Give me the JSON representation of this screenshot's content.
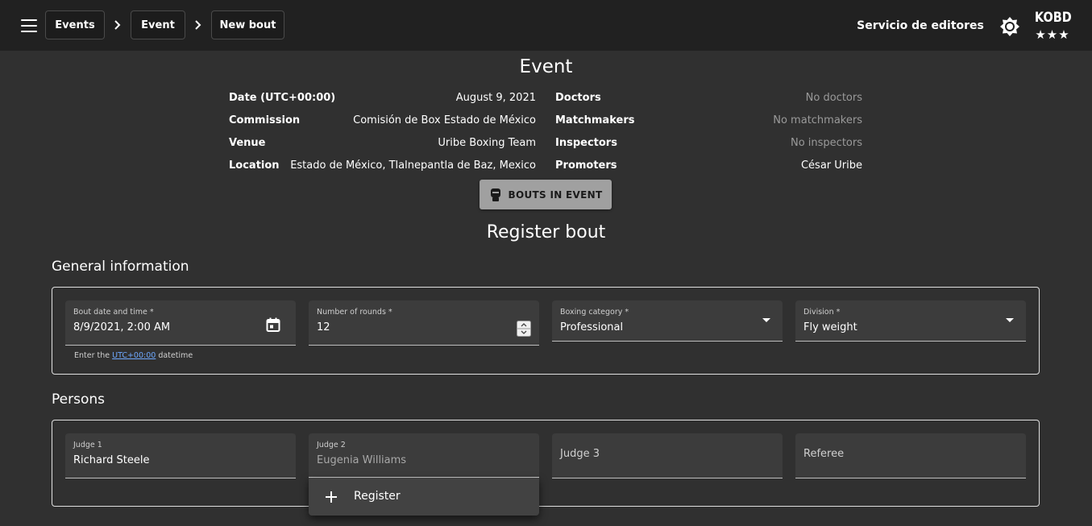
{
  "header": {
    "breadcrumbs": [
      "Events",
      "Event",
      "New bout"
    ],
    "service_link": "Servicio de editores",
    "logo_text": "KOBD",
    "logo_stars": "★★★"
  },
  "event": {
    "title": "Event",
    "left": [
      {
        "label": "Date (UTC+00:00)",
        "value": "August 9, 2021"
      },
      {
        "label": "Commission",
        "value": "Comisión de Box Estado de México"
      },
      {
        "label": "Venue",
        "value": "Uribe Boxing Team"
      },
      {
        "label": "Location",
        "value": "Estado de México, Tlalnepantla de Baz, Mexico"
      }
    ],
    "right": [
      {
        "label": "Doctors",
        "value": "No doctors"
      },
      {
        "label": "Matchmakers",
        "value": "No matchmakers"
      },
      {
        "label": "Inspectors",
        "value": "No inspectors"
      },
      {
        "label": "Promoters",
        "value": "César Uribe"
      }
    ],
    "bouts_button": "BOUTS IN EVENT"
  },
  "register": {
    "title": "Register bout",
    "general": {
      "title": "General information",
      "bout_date": {
        "label": "Bout date and time *",
        "value": "8/9/2021, 2:00 AM"
      },
      "hint_prefix": "Enter the ",
      "hint_link": "UTC+00:00",
      "hint_suffix": " datetime",
      "rounds": {
        "label": "Number of rounds *",
        "value": "12"
      },
      "category": {
        "label": "Boxing category *",
        "value": "Professional"
      },
      "division": {
        "label": "Division *",
        "value": "Fly weight"
      }
    },
    "persons": {
      "title": "Persons",
      "judge1": {
        "label": "Judge 1",
        "value": "Richard Steele"
      },
      "judge2": {
        "label": "Judge 2",
        "placeholder": "Eugenia Williams"
      },
      "judge3": {
        "label": "Judge 3"
      },
      "referee": {
        "label": "Referee"
      },
      "dropdown_item": "Register"
    }
  },
  "colors": {
    "background": "#303030",
    "topbar": "#212121",
    "field": "#3c3c3c",
    "link": "#6ea8fe"
  }
}
